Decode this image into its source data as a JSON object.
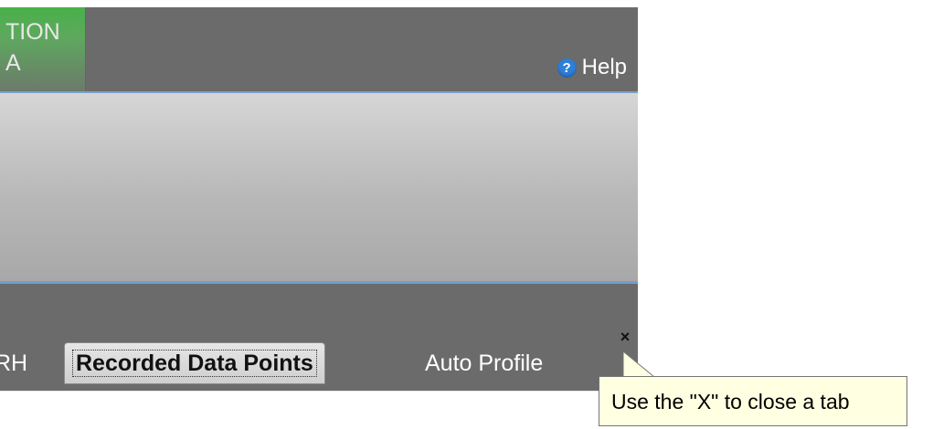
{
  "header": {
    "green_tab_line1": "TION",
    "green_tab_line2": "A",
    "help_label": "Help",
    "help_icon_glyph": "?"
  },
  "tabs": [
    {
      "label": "RH",
      "active": false
    },
    {
      "label": "Recorded Data Points",
      "active": true
    },
    {
      "label": "Auto Profile",
      "active": false
    }
  ],
  "close_glyph": "×",
  "tooltip": {
    "text": "Use the \"X\" to close a tab"
  },
  "colors": {
    "header_bg": "#6b6b6b",
    "green_tab": "#49b04a",
    "accent_line": "#7aa0c8",
    "help_icon": "#2f7fd8",
    "tooltip_bg": "#ffffe1"
  }
}
